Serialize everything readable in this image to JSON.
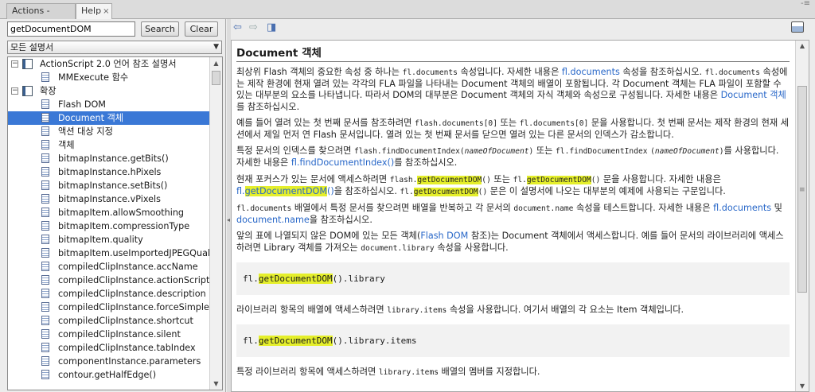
{
  "tabs": [
    {
      "label": "Actions - Frame",
      "active": false
    },
    {
      "label": "Help",
      "active": true,
      "close": "×"
    }
  ],
  "window_controls": "-≡",
  "left": {
    "search_value": "getDocumentDOM",
    "search_button": "Search",
    "clear_button": "Clear",
    "category": "모든 설명서",
    "tree": [
      {
        "label": "ActionScript 2.0 언어 참조 설명서",
        "level": 0,
        "type": "book",
        "expander": "⊟"
      },
      {
        "label": "MMExecute 함수",
        "level": 1,
        "type": "doc"
      },
      {
        "label": "확장",
        "level": 0,
        "type": "book",
        "expander": "⊟"
      },
      {
        "label": "Flash DOM",
        "level": 1,
        "type": "doc"
      },
      {
        "label": "Document 객체",
        "level": 1,
        "type": "doc",
        "selected": true
      },
      {
        "label": "액션 대상 지정",
        "level": 1,
        "type": "doc"
      },
      {
        "label": "객체",
        "level": 1,
        "type": "doc"
      },
      {
        "label": "bitmapInstance.getBits()",
        "level": 1,
        "type": "doc"
      },
      {
        "label": "bitmapInstance.hPixels",
        "level": 1,
        "type": "doc"
      },
      {
        "label": "bitmapInstance.setBits()",
        "level": 1,
        "type": "doc"
      },
      {
        "label": "bitmapInstance.vPixels",
        "level": 1,
        "type": "doc"
      },
      {
        "label": "bitmapItem.allowSmoothing",
        "level": 1,
        "type": "doc"
      },
      {
        "label": "bitmapItem.compressionType",
        "level": 1,
        "type": "doc"
      },
      {
        "label": "bitmapItem.quality",
        "level": 1,
        "type": "doc"
      },
      {
        "label": "bitmapItem.useImportedJPEGQuali...",
        "level": 1,
        "type": "doc"
      },
      {
        "label": "compiledClipInstance.accName",
        "level": 1,
        "type": "doc"
      },
      {
        "label": "compiledClipInstance.actionScript",
        "level": 1,
        "type": "doc"
      },
      {
        "label": "compiledClipInstance.description",
        "level": 1,
        "type": "doc"
      },
      {
        "label": "compiledClipInstance.forceSimple",
        "level": 1,
        "type": "doc"
      },
      {
        "label": "compiledClipInstance.shortcut",
        "level": 1,
        "type": "doc"
      },
      {
        "label": "compiledClipInstance.silent",
        "level": 1,
        "type": "doc"
      },
      {
        "label": "compiledClipInstance.tabIndex",
        "level": 1,
        "type": "doc"
      },
      {
        "label": "componentInstance.parameters",
        "level": 1,
        "type": "doc"
      },
      {
        "label": "contour.getHalfEdge()",
        "level": 1,
        "type": "doc"
      }
    ]
  },
  "colors": {
    "selection": "#3a78d6",
    "link": "#2867c8",
    "highlight": "#e5ef2b"
  },
  "doc": {
    "title": "Document 객체",
    "p1": {
      "a": "최상위 Flash 객체의 중요한 속성 중 하나는 ",
      "code1": "fl.documents",
      "b": " 속성입니다. 자세한 내용은 ",
      "link1": "fl.documents",
      "c": " 속성을 참조하십시오. ",
      "code2": "fl.documents",
      "d": " 속성에는 제작 환경에 현재 열려 있는 각각의 FLA 파일을 나타내는 Document 객체의 배열이 포함됩니다. 각 Document 객체는 FLA 파일이 포함할 수 있는 대부분의 요소를 나타냅니다. 따라서 DOM의 대부분은 Document 객체의 자식 객체와 속성으로 구성됩니다. 자세한 내용은 ",
      "link2": "Document 객체",
      "e": "를 참조하십시오."
    },
    "p2": {
      "a": "예를 들어 열려 있는 첫 번째 문서를 참조하려면 ",
      "code1": "flash.documents[0]",
      "b": " 또는 ",
      "code2": "fl.documents[0]",
      "c": " 문을 사용합니다. 첫 번째 문서는 제작 환경의 현재 세션에서 제일 먼저 연 Flash 문서입니다. 열려 있는 첫 번째 문서를 닫으면 열려 있는 다른 문서의 인덱스가 감소합니다."
    },
    "p3": {
      "a": "특정 문서의 인덱스를 찾으려면 ",
      "code1": "flash.findDocumentIndex(",
      "code1v": "nameOfDocument",
      "code1e": ")",
      "b": " 또는 ",
      "code2": "fl.findDocumentIndex",
      "code3": "(",
      "code3v": "nameOfDocument",
      "code3e": ")",
      "c": "를 사용합니다. 자세한 내용은 ",
      "link1": "fl.findDocumentIndex()",
      "d": "를 참조하십시오."
    },
    "p4": {
      "a": "현재 포커스가 있는 문서에 액세스하려면 ",
      "code1a": "flash.",
      "hl1": "getDocumentDOM",
      "code1b": "()",
      "b": " 또는 ",
      "code2a": "fl.",
      "hl2": "getDocumentDOM",
      "code2b": "()",
      "c": " 문을 사용합니다. 자세한 내용은 ",
      "link1a": "fl.",
      "hl3": "getDocumentDOM",
      "link1b": "()",
      "d": "을 참조하십시오. ",
      "code3a": "fl.",
      "hl4": "getDocumentDOM",
      "code3b": "()",
      "e": " 문은 이 설명서에 나오는 대부분의 예제에 사용되는 구문입니다."
    },
    "p5": {
      "code1": "fl.documents",
      "a": " 배열에서 특정 문서를 찾으려면 배열을 반복하고 각 문서의 ",
      "code2": "document.name",
      "b": " 속성을 테스트합니다.  자세한 내용은 ",
      "link1": "fl.documents",
      "c": " 및 ",
      "link2": "document.name",
      "d": "을 참조하십시오."
    },
    "p6": {
      "a": "앞의 표에 나열되지 않은 DOM에 있는 모든 객체(",
      "link1": "Flash DOM",
      "b": " 참조)는 Document 객체에서 액세스합니다. 예를 들어 문서의 라이브러리에 액세스하려면 Library 객체를 가져오는 ",
      "code1": "document.library",
      "c": " 속성을 사용합니다."
    },
    "code_box1": {
      "a": "fl.",
      "hl": "getDocumentDOM",
      "b": "().library"
    },
    "p7": {
      "a": "라이브러리 항목의 배열에 액세스하려면 ",
      "code1": "library.items",
      "b": " 속성을 사용합니다. 여기서 배열의 각 요소는 Item 객체입니다."
    },
    "code_box2": {
      "a": "fl.",
      "hl": "getDocumentDOM",
      "b": "().library.items"
    },
    "p8": {
      "a": "특정 라이브러리 항목에 액세스하려면 ",
      "code1": "library.items",
      "b": " 배열의 멤버를 지정합니다."
    }
  }
}
